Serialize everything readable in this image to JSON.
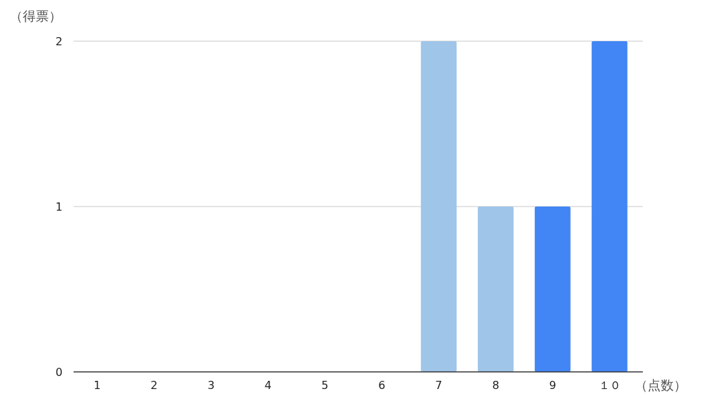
{
  "chart": {
    "chart_data": {
      "type": "bar",
      "ylabel": "（得票）",
      "xlabel": "（点数）",
      "categories": [
        "1",
        "2",
        "3",
        "4",
        "5",
        "6",
        "7",
        "8",
        "9",
        "１０"
      ],
      "series": [
        {
          "color": "#9fc5e8",
          "values": [
            null,
            null,
            null,
            null,
            null,
            null,
            2,
            1,
            null,
            null
          ]
        },
        {
          "color": "#4285f4",
          "values": [
            null,
            null,
            null,
            null,
            null,
            null,
            null,
            null,
            1,
            2
          ]
        }
      ],
      "ylim": [
        0,
        2
      ],
      "yticks": [
        0,
        1,
        2
      ]
    }
  }
}
